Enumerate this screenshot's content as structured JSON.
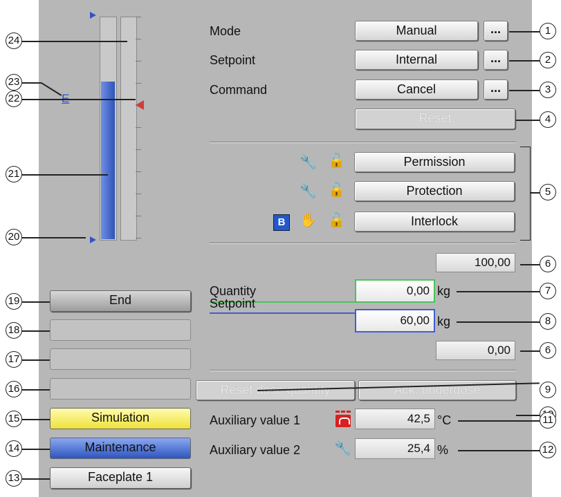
{
  "mode": {
    "label": "Mode",
    "value": "Manual",
    "more": "..."
  },
  "setpoint_src": {
    "label": "Setpoint",
    "value": "Internal",
    "more": "..."
  },
  "command": {
    "label": "Command",
    "value": "Cancel",
    "more": "..."
  },
  "reset_label": "Reset",
  "permission_label": "Permission",
  "protection_label": "Protection",
  "interlock_label": "Interlock",
  "bypass_badge": "B",
  "high_limit": "100,00",
  "low_limit": "0,00",
  "quantity": {
    "label": "Quantity",
    "value": "0,00",
    "unit": "kg"
  },
  "dose_setpoint": {
    "label": "Setpoint",
    "value": "60,00",
    "unit": "kg"
  },
  "reset_dose_label": "Reset dose quantity",
  "ack_underdose_label": "Ack. underdose",
  "aux1": {
    "label": "Auxiliary value 1",
    "value": "42,5",
    "unit": "°C"
  },
  "aux2": {
    "label": "Auxiliary value 2",
    "value": "25,4",
    "unit": "%"
  },
  "bar_label": "E",
  "bar_level_pct": 71,
  "status": {
    "end": "End",
    "empty1": "",
    "empty2": "",
    "empty3": "",
    "simulation": "Simulation",
    "maintenance": "Maintenance",
    "faceplate": "Faceplate 1"
  },
  "callouts": {
    "c1": "1",
    "c2": "2",
    "c3": "3",
    "c4": "4",
    "c5": "5",
    "c6a": "6",
    "c6b": "6",
    "c7": "7",
    "c8": "8",
    "c9": "9",
    "c10": "10",
    "c11": "11",
    "c12": "12",
    "c13": "13",
    "c14": "14",
    "c15": "15",
    "c16": "16",
    "c17": "17",
    "c18": "18",
    "c19": "19",
    "c20": "20",
    "c21": "21",
    "c22": "22",
    "c23": "23",
    "c24": "24"
  },
  "colors": {
    "panel": "#b7b7b7",
    "bar": "#3a62c8",
    "simulation": "#f5ef55",
    "maintenance": "#3f6cd2",
    "quantity_frame": "#4cc25a",
    "setpoint_frame": "#3f5fcf",
    "limit_marker": "#d23a3a"
  }
}
